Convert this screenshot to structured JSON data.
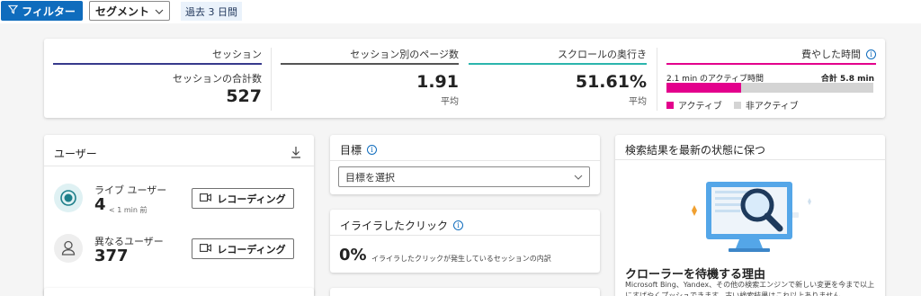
{
  "toolbar": {
    "filter_label": "フィルター",
    "segment_label": "セグメント",
    "date_range": "過去 3 日間"
  },
  "summary": {
    "sessions": {
      "title": "セッション",
      "sub": "セッションの合計数",
      "value": "527",
      "accent": "#373a8c"
    },
    "pages": {
      "title": "セッション別のページ数",
      "value": "1.91",
      "avg": "平均",
      "accent": "#555555"
    },
    "scroll": {
      "title": "スクロールの奥行き",
      "value": "51.61%",
      "avg": "平均",
      "accent": "#2bb5ad"
    },
    "time": {
      "title": "費やした時間",
      "active_text": "2.1 min のアクティブ時間",
      "total_text": "合計 5.8 min",
      "active_fraction": 0.362,
      "legend_active": "アクティブ",
      "legend_inactive": "非アクティブ",
      "accent": "#e3008c",
      "active_color": "#e3008c",
      "inactive_color": "#d4d4d4"
    }
  },
  "users": {
    "title": "ユーザー",
    "live": {
      "label": "ライブ ユーザー",
      "value": "4",
      "note": "< 1 min 前",
      "button": "レコーディング"
    },
    "distinct": {
      "label": "異なるユーザー",
      "value": "377",
      "button": "レコーディング"
    }
  },
  "goals": {
    "title": "目標",
    "select_placeholder": "目標を選択"
  },
  "frustration": {
    "title": "イライラしたクリック",
    "value": "0%",
    "desc": "イライラしたクリックが発生しているセッションの内訳"
  },
  "crawler": {
    "header": "検索結果を最新の状態に保つ",
    "title": "クローラーを待機する理由",
    "desc": "Microsoft Bing、Yandex、その他の検索エンジンで新しい変更を今まで以上にすばやくプッシュできます。古い検索結果はこれ以上ありません。"
  }
}
